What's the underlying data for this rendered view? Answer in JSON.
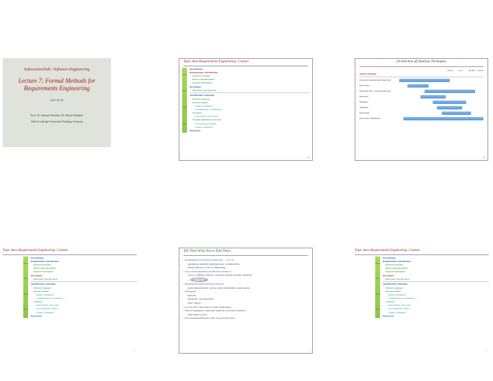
{
  "title": {
    "sup": "Softwaretechnik / Software-Engineering",
    "main": "Lecture 7: Formal Methods for Requirements Engineering",
    "date": "2017-05-29",
    "authors": "Prof. Dr. Andreas Podelski, Dr. Bernd Westphal",
    "affil": "Albert-Ludwigs-Universität Freiburg, Germany"
  },
  "topicHdr": "Topic Area Requirements Engineering: Content",
  "vl": {
    "a": "VL 6",
    "b": "VL 7",
    "c": "VL 8",
    "d": "VL 9"
  },
  "out1": {
    "intro": "Introduction",
    "rs": "Requirements Specification",
    "dp": "Desired Properties",
    "kr": "Kinds of Requirements",
    "at": "Analysis Techniques",
    "doc": "Documents",
    "ds": "Dictionary, Specification",
    "sl": "Specification Languages",
    "nl": "Natural Language",
    "dt": "Decision Tables",
    "ss": "Syntax, Semantics",
    "cc": "Completeness, Consistency, ...",
    "sc": "Scenarios",
    "us": "User Stories, Use Cases",
    "lsc": "Live Sequence Charts",
    "ssx": "Syntax, Semantics",
    "wd": "Working Definition: Software",
    "disc": "Discussion"
  },
  "analysis": {
    "hdr": "(A Selection of) Analysis Techniques",
    "cols": {
      "a": "content",
      "b": "focus",
      "c": "informal ... formal"
    },
    "lbl": "Analysis Technique",
    "rows": [
      "Perspective Reading (desk inspection)",
      "Observation",
      "Reasoning with ... (natural deduction)",
      "Discussion",
      "Modeling",
      "Animation",
      "Prototyping",
      "Provocation / Brainstorm"
    ]
  },
  "tell": {
    "hdr": "Tell Them What You've Told Them...",
    "l1": "Requirements Documents are important — e.g., for",
    "l1a": "negotiation, design & implementation, documentation,",
    "l1b": "testing, delivery, re-use, re-engineering, ...",
    "l2": "A (Good) Requirements Specification should be",
    "l2a": "correct, complete, relevant, consistent, neutral, traceable, (testable)",
    "l2b": "three languages",
    "l3": "Requirements Representations should be",
    "l3a": "easily understandable, precise, easily maintainable, easily usable.",
    "l4": "Distinguish",
    "l4a": "hard/soft,",
    "l4b": "functional / non-functional,",
    "l4c": "'must' options",
    "l5": "It is the task of the analyst to elicit requirements.",
    "l5a": "Natural languages to inherently imprecise; unwritten contexts to",
    "l5b": "name things a priori.",
    "l6": "Do not underestimate the value of a good dictionary."
  },
  "pg": {
    "a": "2/49",
    "b": "3/49",
    "c": "4",
    "d": "4"
  },
  "chart_data": {
    "type": "bar",
    "title": "(A Selection of) Analysis Techniques",
    "xlabel": "focus (content — informal … formal)",
    "ylabel": "Analysis Technique",
    "categories": [
      "Perspective Reading (desk inspection)",
      "Observation",
      "Reasoning with ... (natural deduction)",
      "Discussion",
      "Modeling",
      "Animation",
      "Prototyping",
      "Provocation / Brainstorm"
    ],
    "series": [
      {
        "name": "range",
        "values": [
          [
            0,
            60
          ],
          [
            10,
            35
          ],
          [
            30,
            90
          ],
          [
            25,
            55
          ],
          [
            40,
            80
          ],
          [
            45,
            75
          ],
          [
            50,
            85
          ],
          [
            5,
            100
          ]
        ]
      }
    ],
    "xlim": [
      0,
      100
    ]
  }
}
